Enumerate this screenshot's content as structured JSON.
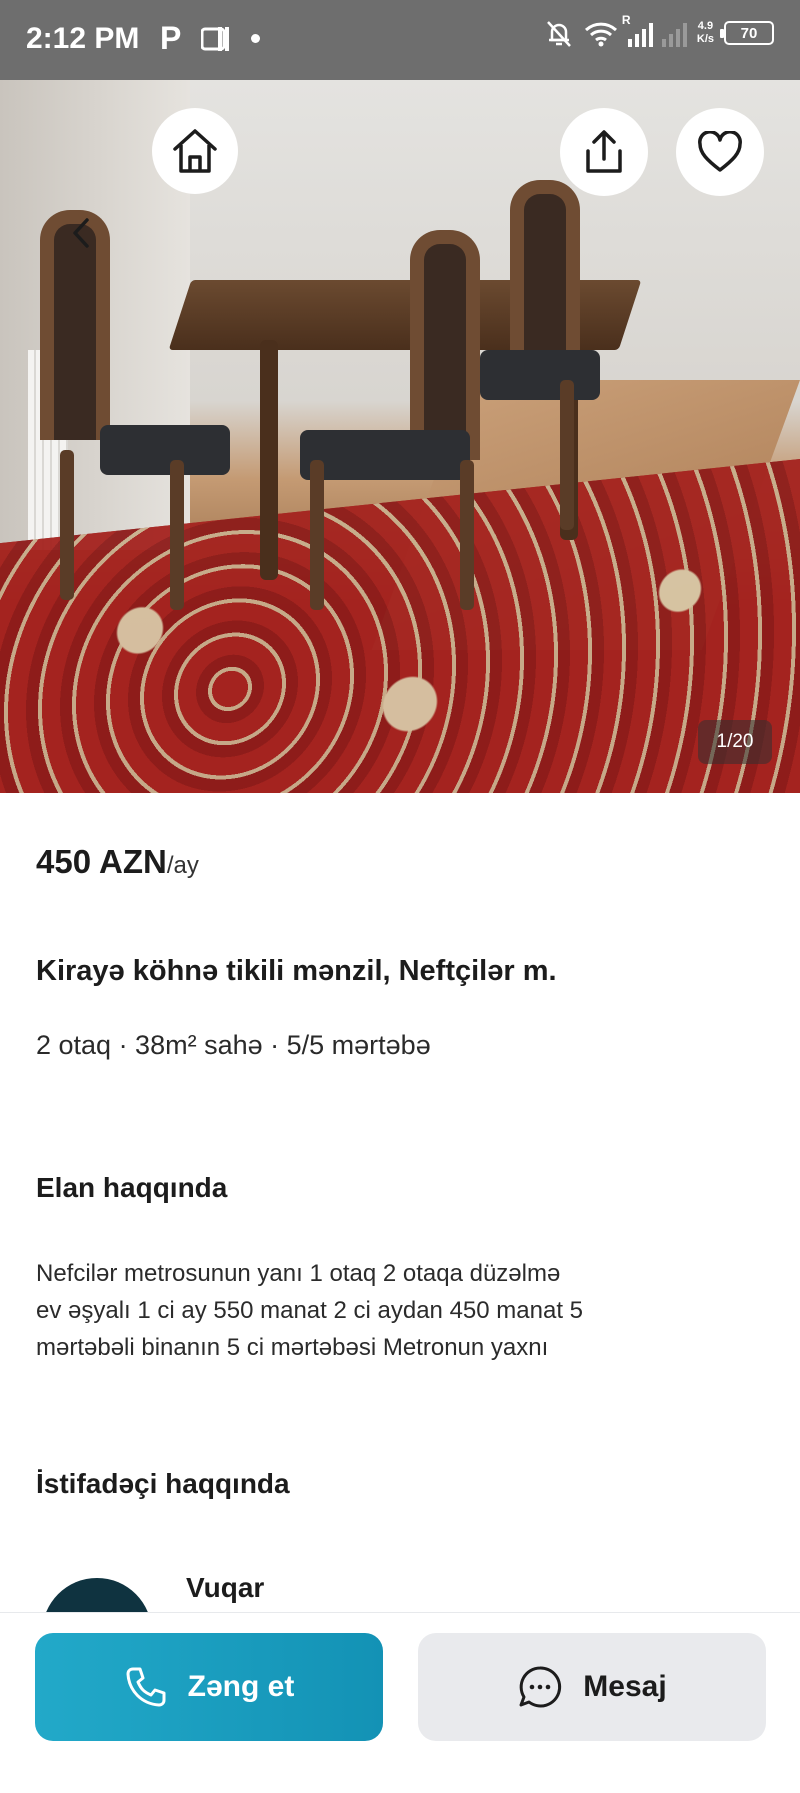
{
  "status_bar": {
    "time": "2:12 PM",
    "carrier_icon_label": "P",
    "net_speed_value": "4.9",
    "net_speed_unit": "K/s",
    "battery": "70",
    "icons": [
      "notifications-muted-icon",
      "wifi-icon",
      "signal-icon"
    ],
    "roaming_label": "R"
  },
  "gallery": {
    "counter": "1/20"
  },
  "listing": {
    "price": "450 AZN",
    "price_unit": "/ay",
    "title": "Kirayə köhnə tikili mənzil, Neftçilər m.",
    "specs": "2 otaq · 38m² sahə · 5/5 mərtəbə"
  },
  "about": {
    "heading": "Elan haqqında",
    "lines": [
      "Nefcilər metrosunun yanı 1 otaq 2 otaqa düzəlmə",
      "ev əşyalı 1 ci ay 550 manat 2 ci aydan 450 manat 5",
      "mərtəbəli binanın 5 ci mərtəbəsi Metronun yaxnı"
    ]
  },
  "user": {
    "heading": "İstifadəçi haqqında",
    "name": "Vuqar"
  },
  "actions": {
    "call_label": "Zəng et",
    "message_label": "Mesaj"
  },
  "colors": {
    "status_bar": "#6e6e6e",
    "call_button": "#1ba0c2",
    "message_button": "#e9eaed",
    "avatar": "#0f3340"
  }
}
